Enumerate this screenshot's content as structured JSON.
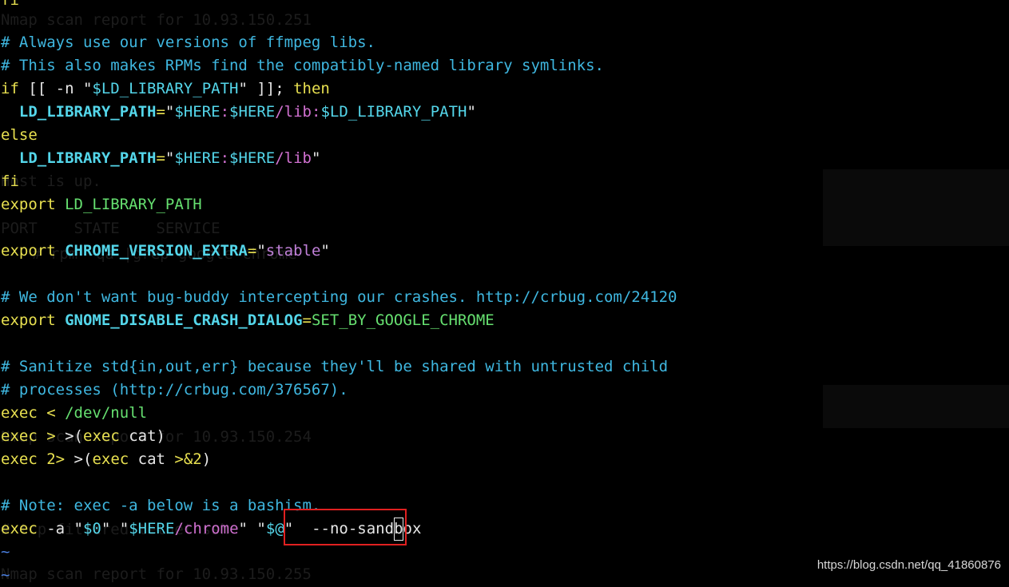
{
  "terminal": {
    "lines": [
      [
        {
          "t": "# Always use our versions of ffmpeg libs.",
          "c": "c-comment"
        }
      ],
      [
        {
          "t": "# This also makes RPMs find the compatibly-named library symlinks.",
          "c": "c-comment"
        }
      ],
      [
        {
          "t": "if",
          "c": "c-kw"
        },
        {
          "t": " [[ -n ",
          "c": "c-plain"
        },
        {
          "t": "\"",
          "c": "c-plain"
        },
        {
          "t": "$LD_LIBRARY_PATH",
          "c": "c-var"
        },
        {
          "t": "\"",
          "c": "c-plain"
        },
        {
          "t": " ]]; ",
          "c": "c-plain"
        },
        {
          "t": "then",
          "c": "c-kw"
        }
      ],
      [
        {
          "t": "  LD_LIBRARY_PATH",
          "c": "c-var bold"
        },
        {
          "t": "=",
          "c": "c-op"
        },
        {
          "t": "\"",
          "c": "c-plain"
        },
        {
          "t": "$HERE",
          "c": "c-var"
        },
        {
          "t": ":",
          "c": "c-str"
        },
        {
          "t": "$HERE",
          "c": "c-var"
        },
        {
          "t": "/lib:",
          "c": "c-str"
        },
        {
          "t": "$LD_LIBRARY_PATH",
          "c": "c-var"
        },
        {
          "t": "\"",
          "c": "c-plain"
        }
      ],
      [
        {
          "t": "else",
          "c": "c-kw"
        }
      ],
      [
        {
          "t": "  LD_LIBRARY_PATH",
          "c": "c-var bold"
        },
        {
          "t": "=",
          "c": "c-op"
        },
        {
          "t": "\"",
          "c": "c-plain"
        },
        {
          "t": "$HERE",
          "c": "c-var"
        },
        {
          "t": ":",
          "c": "c-str"
        },
        {
          "t": "$HERE",
          "c": "c-var"
        },
        {
          "t": "/lib",
          "c": "c-str"
        },
        {
          "t": "\"",
          "c": "c-plain"
        }
      ],
      [
        {
          "t": "fi",
          "c": "c-kw"
        }
      ],
      [
        {
          "t": "export",
          "c": "c-kw"
        },
        {
          "t": " LD_LIBRARY_PATH",
          "c": "c-green"
        }
      ],
      [
        {
          "t": "",
          "c": "c-plain"
        }
      ],
      [
        {
          "t": "export",
          "c": "c-kw"
        },
        {
          "t": " ",
          "c": "c-plain"
        },
        {
          "t": "CHROME_VERSION_EXTRA",
          "c": "c-var bold"
        },
        {
          "t": "=",
          "c": "c-op"
        },
        {
          "t": "\"",
          "c": "c-plain"
        },
        {
          "t": "stable",
          "c": "c-purple"
        },
        {
          "t": "\"",
          "c": "c-plain"
        }
      ],
      [
        {
          "t": "",
          "c": "c-plain"
        }
      ],
      [
        {
          "t": "# We don't want bug-buddy intercepting our crashes. ",
          "c": "c-comment"
        },
        {
          "t": "http://crbug.com/24120",
          "c": "c-url"
        }
      ],
      [
        {
          "t": "export",
          "c": "c-kw"
        },
        {
          "t": " ",
          "c": "c-plain"
        },
        {
          "t": "GNOME_DISABLE_CRASH_DIALOG",
          "c": "c-var bold"
        },
        {
          "t": "=",
          "c": "c-op"
        },
        {
          "t": "SET_BY_GOOGLE_CHROME",
          "c": "c-green"
        }
      ],
      [
        {
          "t": "",
          "c": "c-plain"
        }
      ],
      [
        {
          "t": "# Sanitize std{in,out,err} because they'll be shared with untrusted child",
          "c": "c-comment"
        }
      ],
      [
        {
          "t": "# processes (http://crbug.com/376567).",
          "c": "c-comment"
        }
      ],
      [
        {
          "t": "exec",
          "c": "c-kw"
        },
        {
          "t": " ",
          "c": "c-plain"
        },
        {
          "t": "<",
          "c": "c-op"
        },
        {
          "t": " /dev/null",
          "c": "c-green"
        }
      ],
      [
        {
          "t": "exec",
          "c": "c-kw"
        },
        {
          "t": " ",
          "c": "c-plain"
        },
        {
          "t": ">",
          "c": "c-op"
        },
        {
          "t": " >(",
          "c": "c-plain"
        },
        {
          "t": "exec",
          "c": "c-kw"
        },
        {
          "t": " cat)",
          "c": "c-plain"
        }
      ],
      [
        {
          "t": "exec",
          "c": "c-kw"
        },
        {
          "t": " ",
          "c": "c-plain"
        },
        {
          "t": "2>",
          "c": "c-op"
        },
        {
          "t": " >(",
          "c": "c-plain"
        },
        {
          "t": "exec",
          "c": "c-kw"
        },
        {
          "t": " cat ",
          "c": "c-plain"
        },
        {
          "t": ">&2",
          "c": "c-op"
        },
        {
          "t": ")",
          "c": "c-plain"
        }
      ],
      [
        {
          "t": "",
          "c": "c-plain"
        }
      ],
      [
        {
          "t": "# Note: exec -a below is a bashism.",
          "c": "c-comment"
        }
      ],
      [
        {
          "t": "exec",
          "c": "c-kw"
        },
        {
          "t": " -a ",
          "c": "c-plain"
        },
        {
          "t": "\"",
          "c": "c-plain"
        },
        {
          "t": "$0",
          "c": "c-var"
        },
        {
          "t": "\"",
          "c": "c-plain"
        },
        {
          "t": " ",
          "c": "c-plain"
        },
        {
          "t": "\"",
          "c": "c-plain"
        },
        {
          "t": "$HERE",
          "c": "c-var"
        },
        {
          "t": "/chrome",
          "c": "c-str"
        },
        {
          "t": "\"",
          "c": "c-plain"
        },
        {
          "t": " ",
          "c": "c-plain"
        },
        {
          "t": "\"",
          "c": "c-plain"
        },
        {
          "t": "$@",
          "c": "c-var"
        },
        {
          "t": "\"",
          "c": "c-plain"
        },
        {
          "t": "  --no-sand",
          "c": "c-plain"
        },
        {
          "t": "b",
          "c": "c-plain cursor"
        },
        {
          "t": "ox",
          "c": "c-plain"
        }
      ],
      [
        {
          "t": "~",
          "c": "c-tilde"
        }
      ],
      [
        {
          "t": "~",
          "c": "c-tilde"
        }
      ]
    ],
    "top_partial": "fi",
    "ghost_text": [
      "Nmap scan report for 10.93.150.251",
      "Host is up.",
      "PORT    STATE    SERVICE",
      "# rpm -qa |grep google-chrome",
      "Nmap scan report for 10.93.150.254",
      "# tcp filtered telnet ssh",
      "Nmap scan report for 10.93.150.255"
    ]
  },
  "watermark": "https://blog.csdn.net/qq_41860876"
}
